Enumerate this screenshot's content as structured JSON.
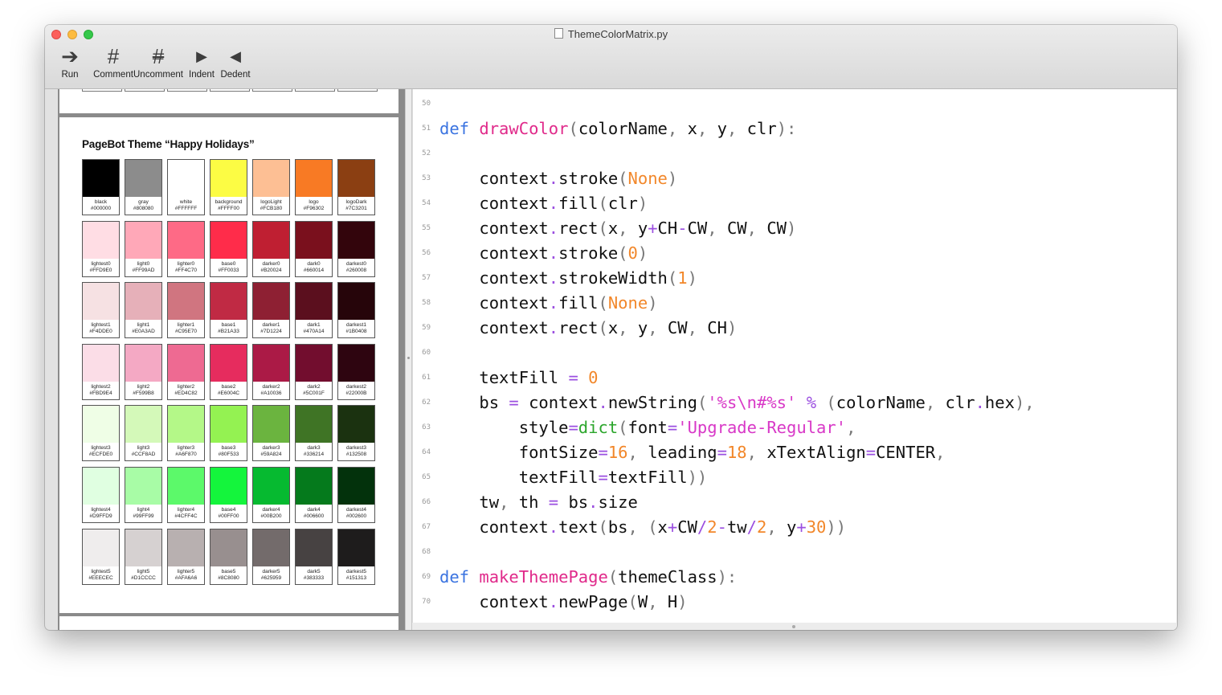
{
  "window": {
    "title": "ThemeColorMatrix.py"
  },
  "toolbar": [
    {
      "label": "Run",
      "icon": "run-arrow-icon",
      "glyph": "➔"
    },
    {
      "label": "Comment",
      "icon": "hash-icon",
      "glyph": "#"
    },
    {
      "label": "Uncomment",
      "icon": "hash-slash-icon",
      "glyph": "#"
    },
    {
      "label": "Indent",
      "icon": "indent-triangle-icon",
      "glyph": "▶"
    },
    {
      "label": "Dedent",
      "icon": "dedent-triangle-icon",
      "glyph": "◀"
    }
  ],
  "preview": {
    "page_title": "PageBot Theme “Happy Holidays”",
    "rows": [
      [
        {
          "name": "black",
          "hex": "#000000",
          "color": "#000000"
        },
        {
          "name": "gray",
          "hex": "#808080",
          "color": "#8c8c8c"
        },
        {
          "name": "white",
          "hex": "#FFFFFF",
          "color": "#ffffff"
        },
        {
          "name": "background",
          "hex": "#FFFF00",
          "color": "#fcfc44"
        },
        {
          "name": "logoLight",
          "hex": "#FCB180",
          "color": "#fdbf94"
        },
        {
          "name": "logo",
          "hex": "#F96302",
          "color": "#f87a24"
        },
        {
          "name": "logoDark",
          "hex": "#7C3201",
          "color": "#8b3f12"
        }
      ],
      [
        {
          "name": "lightest0",
          "hex": "#FFD9E0",
          "color": "#ffdde4"
        },
        {
          "name": "light0",
          "hex": "#FF99AD",
          "color": "#ffa8b8"
        },
        {
          "name": "lighter0",
          "hex": "#FF4C70",
          "color": "#fe6a86"
        },
        {
          "name": "base0",
          "hex": "#FF0033",
          "color": "#ff2c4a"
        },
        {
          "name": "darker0",
          "hex": "#B20024",
          "color": "#bf1f32"
        },
        {
          "name": "dark0",
          "hex": "#660014",
          "color": "#7a101d"
        },
        {
          "name": "darkest0",
          "hex": "#260008",
          "color": "#33050c"
        }
      ],
      [
        {
          "name": "lightest1",
          "hex": "#F4DDE0",
          "color": "#f6e1e3"
        },
        {
          "name": "light1",
          "hex": "#E0A3AD",
          "color": "#e6b0b9"
        },
        {
          "name": "lighter1",
          "hex": "#C95E70",
          "color": "#d07580"
        },
        {
          "name": "base1",
          "hex": "#B21A33",
          "color": "#c02a44"
        },
        {
          "name": "darker1",
          "hex": "#7D1224",
          "color": "#8e2033"
        },
        {
          "name": "dark1",
          "hex": "#470A14",
          "color": "#5b0f1e"
        },
        {
          "name": "darkest1",
          "hex": "#1B0408",
          "color": "#26050a"
        }
      ],
      [
        {
          "name": "lightest2",
          "hex": "#FBD9E4",
          "color": "#fbdde7"
        },
        {
          "name": "light2",
          "hex": "#F599B8",
          "color": "#f4a9c4"
        },
        {
          "name": "lighter2",
          "hex": "#ED4C82",
          "color": "#ee6a92"
        },
        {
          "name": "base2",
          "hex": "#E6004C",
          "color": "#e62c5e"
        },
        {
          "name": "darker2",
          "hex": "#A10036",
          "color": "#ab1a46"
        },
        {
          "name": "dark2",
          "hex": "#5C001F",
          "color": "#720d2e"
        },
        {
          "name": "darkest2",
          "hex": "#22000B",
          "color": "#2e0510"
        }
      ],
      [
        {
          "name": "lightest3",
          "hex": "#ECFDE0",
          "color": "#effee6"
        },
        {
          "name": "light3",
          "hex": "#CCF8AD",
          "color": "#d4f9b9"
        },
        {
          "name": "lighter3",
          "hex": "#A6F870",
          "color": "#b4f888"
        },
        {
          "name": "base3",
          "hex": "#80F533",
          "color": "#94f252"
        },
        {
          "name": "darker3",
          "hex": "#59A824",
          "color": "#6bb43f"
        },
        {
          "name": "dark3",
          "hex": "#336214",
          "color": "#3f7425"
        },
        {
          "name": "darkest3",
          "hex": "#132508",
          "color": "#1b3210"
        }
      ],
      [
        {
          "name": "lightest4",
          "hex": "#D9FFD9",
          "color": "#e0ffe1"
        },
        {
          "name": "light4",
          "hex": "#99FF99",
          "color": "#a8fca6"
        },
        {
          "name": "lighter4",
          "hex": "#4CFF4C",
          "color": "#5cf96a"
        },
        {
          "name": "base4",
          "hex": "#00FF00",
          "color": "#14f53c"
        },
        {
          "name": "darker4",
          "hex": "#00B200",
          "color": "#06ba30"
        },
        {
          "name": "dark4",
          "hex": "#006600",
          "color": "#057a1c"
        },
        {
          "name": "darkest4",
          "hex": "#002600",
          "color": "#03320c"
        }
      ],
      [
        {
          "name": "lightest5",
          "hex": "#EEECEC",
          "color": "#efeded"
        },
        {
          "name": "light5",
          "hex": "#D1CCCC",
          "color": "#d6d1d1"
        },
        {
          "name": "lighter5",
          "hex": "#AFA6A6",
          "color": "#b8b0b0"
        },
        {
          "name": "base5",
          "hex": "#8C8080",
          "color": "#988f8f"
        },
        {
          "name": "darker5",
          "hex": "#625959",
          "color": "#736b6b"
        },
        {
          "name": "dark5",
          "hex": "#383333",
          "color": "#474242"
        },
        {
          "name": "darkest5",
          "hex": "#151313",
          "color": "#1e1c1c"
        }
      ]
    ]
  },
  "editor": {
    "first_line": 50,
    "lines": [
      [],
      [
        [
          "k",
          "def"
        ],
        [
          "t",
          " "
        ],
        [
          "f",
          "drawColor"
        ],
        [
          "p",
          "("
        ],
        [
          "t",
          "colorName"
        ],
        [
          "p",
          ","
        ],
        [
          "t",
          " x"
        ],
        [
          "p",
          ","
        ],
        [
          "t",
          " y"
        ],
        [
          "p",
          ","
        ],
        [
          "t",
          " clr"
        ],
        [
          "p",
          "):"
        ]
      ],
      [],
      [
        [
          "t",
          "    context"
        ],
        [
          "o",
          "."
        ],
        [
          "t",
          "stroke"
        ],
        [
          "p",
          "("
        ],
        [
          "n",
          "None"
        ],
        [
          "p",
          ")"
        ]
      ],
      [
        [
          "t",
          "    context"
        ],
        [
          "o",
          "."
        ],
        [
          "t",
          "fill"
        ],
        [
          "p",
          "("
        ],
        [
          "t",
          "clr"
        ],
        [
          "p",
          ")"
        ]
      ],
      [
        [
          "t",
          "    context"
        ],
        [
          "o",
          "."
        ],
        [
          "t",
          "rect"
        ],
        [
          "p",
          "("
        ],
        [
          "t",
          "x"
        ],
        [
          "p",
          ","
        ],
        [
          "t",
          " y"
        ],
        [
          "o",
          "+"
        ],
        [
          "t",
          "CH"
        ],
        [
          "o",
          "-"
        ],
        [
          "t",
          "CW"
        ],
        [
          "p",
          ","
        ],
        [
          "t",
          " CW"
        ],
        [
          "p",
          ","
        ],
        [
          "t",
          " CW"
        ],
        [
          "p",
          ")"
        ]
      ],
      [
        [
          "t",
          "    context"
        ],
        [
          "o",
          "."
        ],
        [
          "t",
          "stroke"
        ],
        [
          "p",
          "("
        ],
        [
          "n",
          "0"
        ],
        [
          "p",
          ")"
        ]
      ],
      [
        [
          "t",
          "    context"
        ],
        [
          "o",
          "."
        ],
        [
          "t",
          "strokeWidth"
        ],
        [
          "p",
          "("
        ],
        [
          "n",
          "1"
        ],
        [
          "p",
          ")"
        ]
      ],
      [
        [
          "t",
          "    context"
        ],
        [
          "o",
          "."
        ],
        [
          "t",
          "fill"
        ],
        [
          "p",
          "("
        ],
        [
          "n",
          "None"
        ],
        [
          "p",
          ")"
        ]
      ],
      [
        [
          "t",
          "    context"
        ],
        [
          "o",
          "."
        ],
        [
          "t",
          "rect"
        ],
        [
          "p",
          "("
        ],
        [
          "t",
          "x"
        ],
        [
          "p",
          ","
        ],
        [
          "t",
          " y"
        ],
        [
          "p",
          ","
        ],
        [
          "t",
          " CW"
        ],
        [
          "p",
          ","
        ],
        [
          "t",
          " CH"
        ],
        [
          "p",
          ")"
        ]
      ],
      [],
      [
        [
          "t",
          "    textFill "
        ],
        [
          "o",
          "="
        ],
        [
          "t",
          " "
        ],
        [
          "n",
          "0"
        ]
      ],
      [
        [
          "t",
          "    bs "
        ],
        [
          "o",
          "="
        ],
        [
          "t",
          " context"
        ],
        [
          "o",
          "."
        ],
        [
          "t",
          "newString"
        ],
        [
          "p",
          "("
        ],
        [
          "s",
          "'%s\\n#%s'"
        ],
        [
          "t",
          " "
        ],
        [
          "o",
          "%"
        ],
        [
          "t",
          " "
        ],
        [
          "p",
          "("
        ],
        [
          "t",
          "colorName"
        ],
        [
          "p",
          ","
        ],
        [
          "t",
          " clr"
        ],
        [
          "o",
          "."
        ],
        [
          "t",
          "hex"
        ],
        [
          "p",
          "),"
        ]
      ],
      [
        [
          "t",
          "        style"
        ],
        [
          "o",
          "="
        ],
        [
          "b",
          "dict"
        ],
        [
          "p",
          "("
        ],
        [
          "t",
          "font"
        ],
        [
          "o",
          "="
        ],
        [
          "s",
          "'Upgrade-Regular'"
        ],
        [
          "p",
          ","
        ]
      ],
      [
        [
          "t",
          "        fontSize"
        ],
        [
          "o",
          "="
        ],
        [
          "n",
          "16"
        ],
        [
          "p",
          ","
        ],
        [
          "t",
          " leading"
        ],
        [
          "o",
          "="
        ],
        [
          "n",
          "18"
        ],
        [
          "p",
          ","
        ],
        [
          "t",
          " xTextAlign"
        ],
        [
          "o",
          "="
        ],
        [
          "t",
          "CENTER"
        ],
        [
          "p",
          ","
        ]
      ],
      [
        [
          "t",
          "        textFill"
        ],
        [
          "o",
          "="
        ],
        [
          "t",
          "textFill"
        ],
        [
          "p",
          "))"
        ]
      ],
      [
        [
          "t",
          "    tw"
        ],
        [
          "p",
          ","
        ],
        [
          "t",
          " th "
        ],
        [
          "o",
          "="
        ],
        [
          "t",
          " bs"
        ],
        [
          "o",
          "."
        ],
        [
          "t",
          "size"
        ]
      ],
      [
        [
          "t",
          "    context"
        ],
        [
          "o",
          "."
        ],
        [
          "t",
          "text"
        ],
        [
          "p",
          "("
        ],
        [
          "t",
          "bs"
        ],
        [
          "p",
          ","
        ],
        [
          "t",
          " "
        ],
        [
          "p",
          "("
        ],
        [
          "t",
          "x"
        ],
        [
          "o",
          "+"
        ],
        [
          "t",
          "CW"
        ],
        [
          "o",
          "/"
        ],
        [
          "n",
          "2"
        ],
        [
          "o",
          "-"
        ],
        [
          "t",
          "tw"
        ],
        [
          "o",
          "/"
        ],
        [
          "n",
          "2"
        ],
        [
          "p",
          ","
        ],
        [
          "t",
          " y"
        ],
        [
          "o",
          "+"
        ],
        [
          "n",
          "30"
        ],
        [
          "p",
          "))"
        ]
      ],
      [],
      [
        [
          "k",
          "def"
        ],
        [
          "t",
          " "
        ],
        [
          "f",
          "makeThemePage"
        ],
        [
          "p",
          "("
        ],
        [
          "t",
          "themeClass"
        ],
        [
          "p",
          "):"
        ]
      ],
      [
        [
          "t",
          "    context"
        ],
        [
          "o",
          "."
        ],
        [
          "t",
          "newPage"
        ],
        [
          "p",
          "("
        ],
        [
          "t",
          "W"
        ],
        [
          "p",
          ","
        ],
        [
          "t",
          " H"
        ],
        [
          "p",
          ")"
        ]
      ],
      [
        [
          "t",
          "    "
        ]
      ]
    ]
  }
}
